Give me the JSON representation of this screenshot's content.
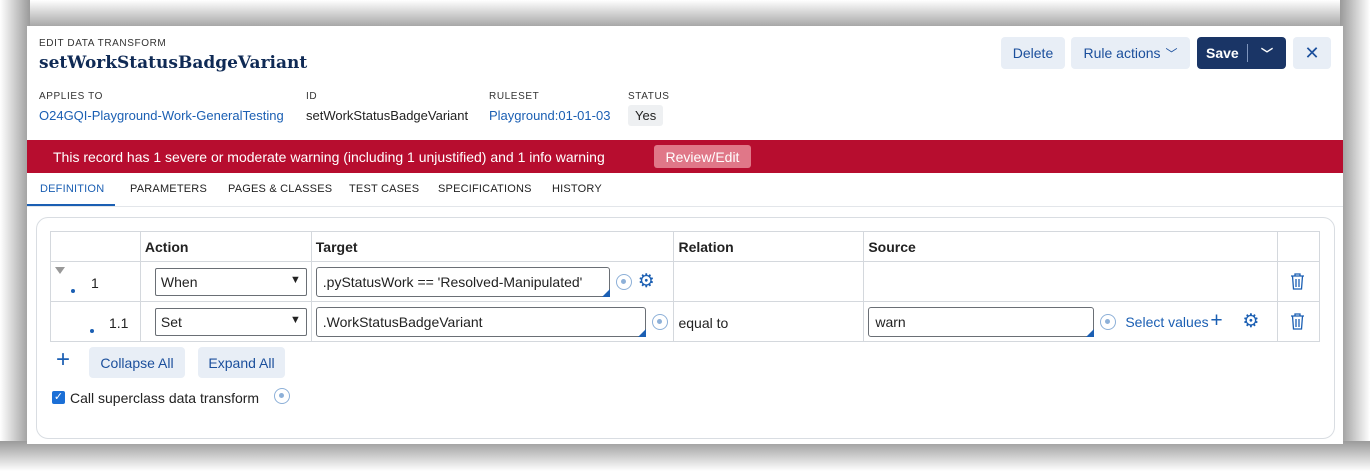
{
  "header": {
    "kicker": "EDIT DATA TRANSFORM",
    "title": "setWorkStatusBadgeVariant",
    "delete_label": "Delete",
    "rule_actions_label": "Rule actions",
    "save_label": "Save",
    "close_glyph": "✕"
  },
  "meta": {
    "applies_to_label": "APPLIES TO",
    "applies_to_value": "O24GQI-Playground-Work-GeneralTesting",
    "id_label": "ID",
    "id_value": "setWorkStatusBadgeVariant",
    "ruleset_label": "RULESET",
    "ruleset_value": "Playground:01-01-03",
    "status_label": "STATUS",
    "status_value": "Yes"
  },
  "warning": {
    "message": "This record has 1 severe or moderate warning (including 1 unjustified) and 1 info warning",
    "action_label": "Review/Edit"
  },
  "tabs": [
    {
      "label": "DEFINITION",
      "active": true
    },
    {
      "label": "PARAMETERS",
      "active": false
    },
    {
      "label": "PAGES & CLASSES",
      "active": false
    },
    {
      "label": "TEST CASES",
      "active": false
    },
    {
      "label": "SPECIFICATIONS",
      "active": false
    },
    {
      "label": "HISTORY",
      "active": false
    }
  ],
  "grid": {
    "columns": [
      "",
      "Action",
      "Target",
      "Relation",
      "Source",
      ""
    ],
    "rows": [
      {
        "num": "1",
        "action": "When",
        "target": ".pyStatusWork == 'Resolved-Manipulated'",
        "relation": "",
        "source": ""
      },
      {
        "num": "1.1",
        "action": "Set",
        "target": ".WorkStatusBadgeVariant",
        "relation": "equal to",
        "source": "warn",
        "source_action": "Select values"
      }
    ]
  },
  "controls": {
    "add_glyph": "+",
    "collapse_label": "Collapse All",
    "expand_label": "Expand All",
    "superclass_label": "Call superclass data transform",
    "superclass_checked": true
  },
  "colors": {
    "brand_navy": "#1a3566",
    "link_blue": "#1b5fb3",
    "warning_red": "#b70d2f"
  }
}
